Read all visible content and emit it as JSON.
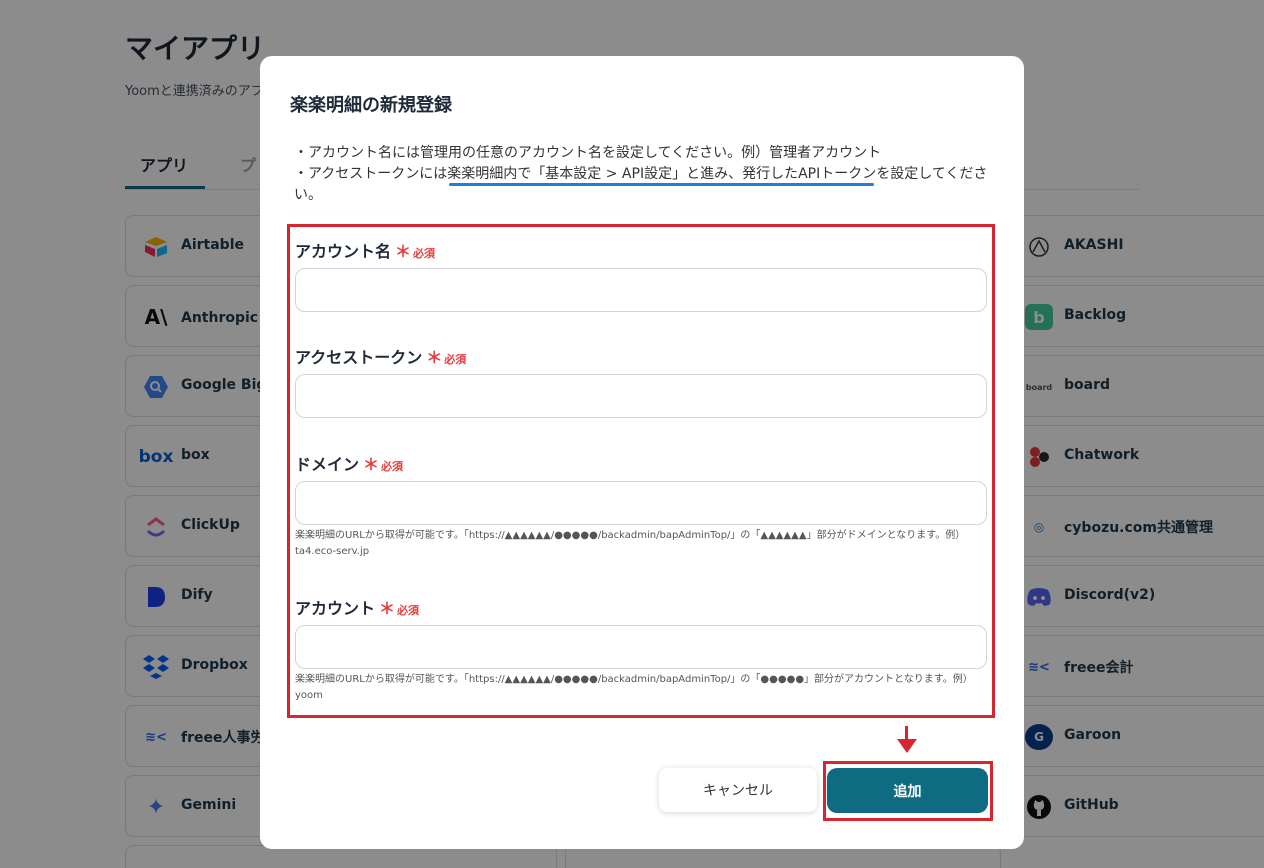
{
  "page": {
    "title": "マイアプリ",
    "subtitle": "Yoomと連携済みのアプ",
    "tabs": [
      "アプリ",
      "プ"
    ]
  },
  "apps_left": [
    {
      "name": "Airtable",
      "icon": "airtable-icon"
    },
    {
      "name": "Anthropic（",
      "icon": "anthropic-icon"
    },
    {
      "name": "Google BigQ",
      "icon": "bigquery-icon"
    },
    {
      "name": "box",
      "icon": "box-icon"
    },
    {
      "name": "ClickUp",
      "icon": "clickup-icon"
    },
    {
      "name": "Dify",
      "icon": "dify-icon"
    },
    {
      "name": "Dropbox",
      "icon": "dropbox-icon"
    },
    {
      "name": "freee人事労務",
      "icon": "freee-icon"
    },
    {
      "name": "Gemini",
      "icon": "gemini-icon"
    }
  ],
  "apps_right": [
    {
      "name": "AKASHI",
      "icon": "akashi-icon"
    },
    {
      "name": "Backlog",
      "icon": "backlog-icon"
    },
    {
      "name": "board",
      "icon": "board-icon"
    },
    {
      "name": "Chatwork",
      "icon": "chatwork-icon"
    },
    {
      "name": "cybozu.com共通管理",
      "icon": "cybozu-icon"
    },
    {
      "name": "Discord(v2)",
      "icon": "discord-icon"
    },
    {
      "name": "freee会計",
      "icon": "freee-icon"
    },
    {
      "name": "Garoon",
      "icon": "garoon-icon"
    },
    {
      "name": "GitHub",
      "icon": "github-icon"
    }
  ],
  "modal": {
    "title": "楽楽明細の新規登録",
    "note1": "・アカウント名には管理用の任意のアカウント名を設定してください。例）管理者アカウント",
    "note2": "・アクセストークンには楽楽明細内で「基本設定 > API設定」と進み、発行したAPIトークンを設定してください。",
    "required_mark": "＊",
    "required_text": "必須",
    "fields": [
      {
        "label": "アカウント名",
        "value": ""
      },
      {
        "label": "アクセストークン",
        "value": ""
      },
      {
        "label": "ドメイン",
        "value": "",
        "help": "楽楽明細のURLから取得が可能です。「https://▲▲▲▲▲▲/●●●●●/backadmin/bapAdminTop/」の「▲▲▲▲▲▲」部分がドメインとなります。例）ta4.eco-serv.jp"
      },
      {
        "label": "アカウント",
        "value": "",
        "help": "楽楽明細のURLから取得が可能です。「https://▲▲▲▲▲▲/●●●●●/backadmin/bapAdminTop/」の「●●●●●」部分がアカウントとなります。例）yoom"
      }
    ],
    "cancel_label": "キャンセル",
    "submit_label": "追加"
  },
  "colors": {
    "accent": "#0f6b82",
    "highlight_frame": "#d7262e",
    "underline": "#1e7fd6",
    "required": "#e53e3e"
  }
}
